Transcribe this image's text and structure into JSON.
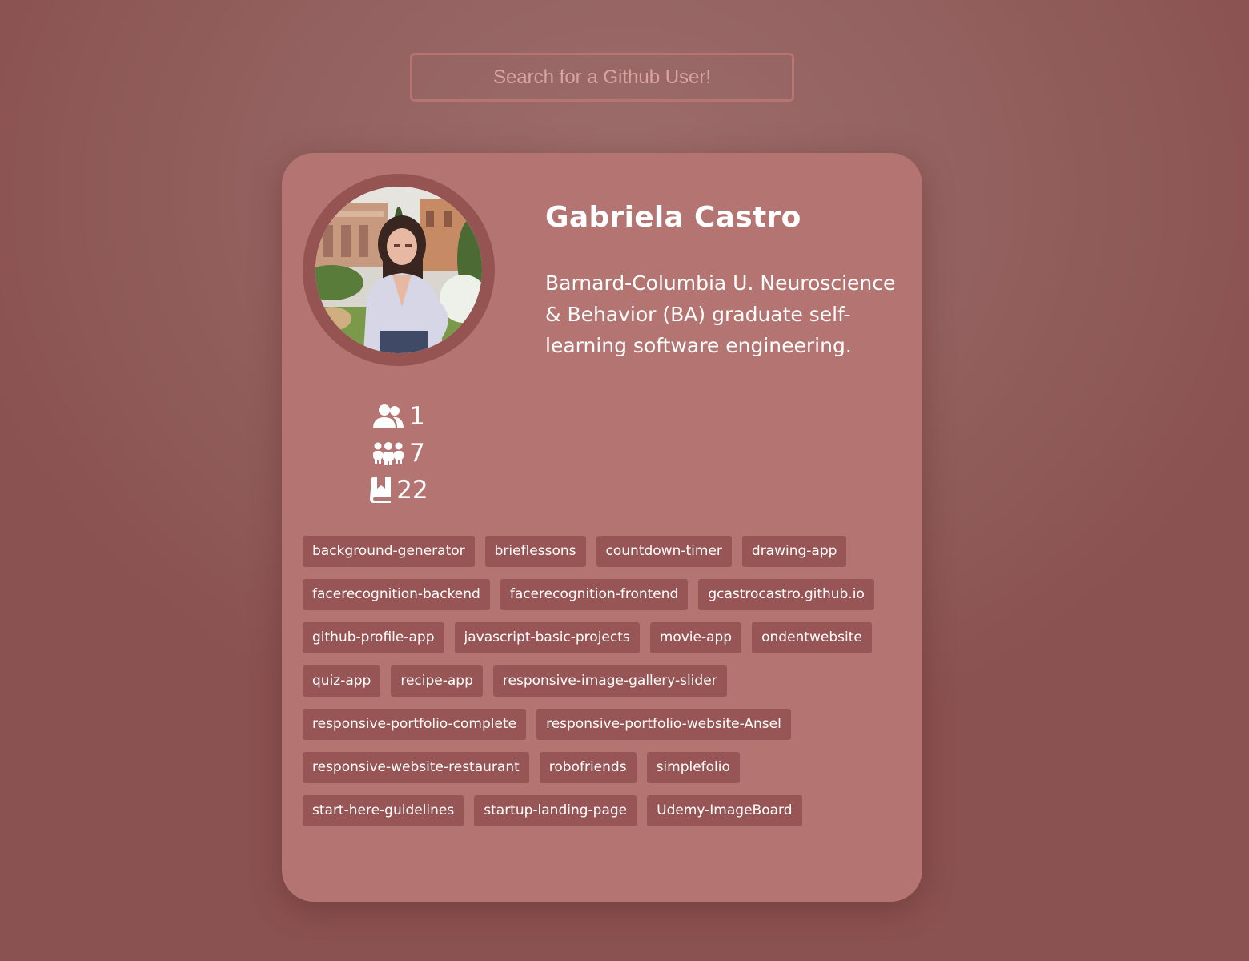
{
  "search": {
    "placeholder": "Search for a Github User!",
    "value": ""
  },
  "profile": {
    "name": "Gabriela Castro",
    "bio": "Barnard-Columbia U. Neuroscience & Behavior (BA) graduate self-learning software engineering.",
    "avatar_icon": "user-photo"
  },
  "stats": {
    "followers": "1",
    "following": "7",
    "repos": "22",
    "followers_icon": "user-friends-icon",
    "following_icon": "users-group-icon",
    "repos_icon": "book-icon"
  },
  "repos": [
    "background-generator",
    "brieflessons",
    "countdown-timer",
    "drawing-app",
    "facerecognition-backend",
    "facerecognition-frontend",
    "gcastrocastro.github.io",
    "github-profile-app",
    "javascript-basic-projects",
    "movie-app",
    "ondentwebsite",
    "quiz-app",
    "recipe-app",
    "responsive-image-gallery-slider",
    "responsive-portfolio-complete",
    "responsive-portfolio-website-Ansel",
    "responsive-website-restaurant",
    "robofriends",
    "simplefolio",
    "start-here-guidelines",
    "startup-landing-page",
    "Udemy-ImageBoard"
  ],
  "colors": {
    "background": "#8f5a58",
    "card": "#b47572",
    "tag": "#985555",
    "avatar_ring": "#955352",
    "search_border": "#b87472",
    "text": "#ffffff"
  }
}
